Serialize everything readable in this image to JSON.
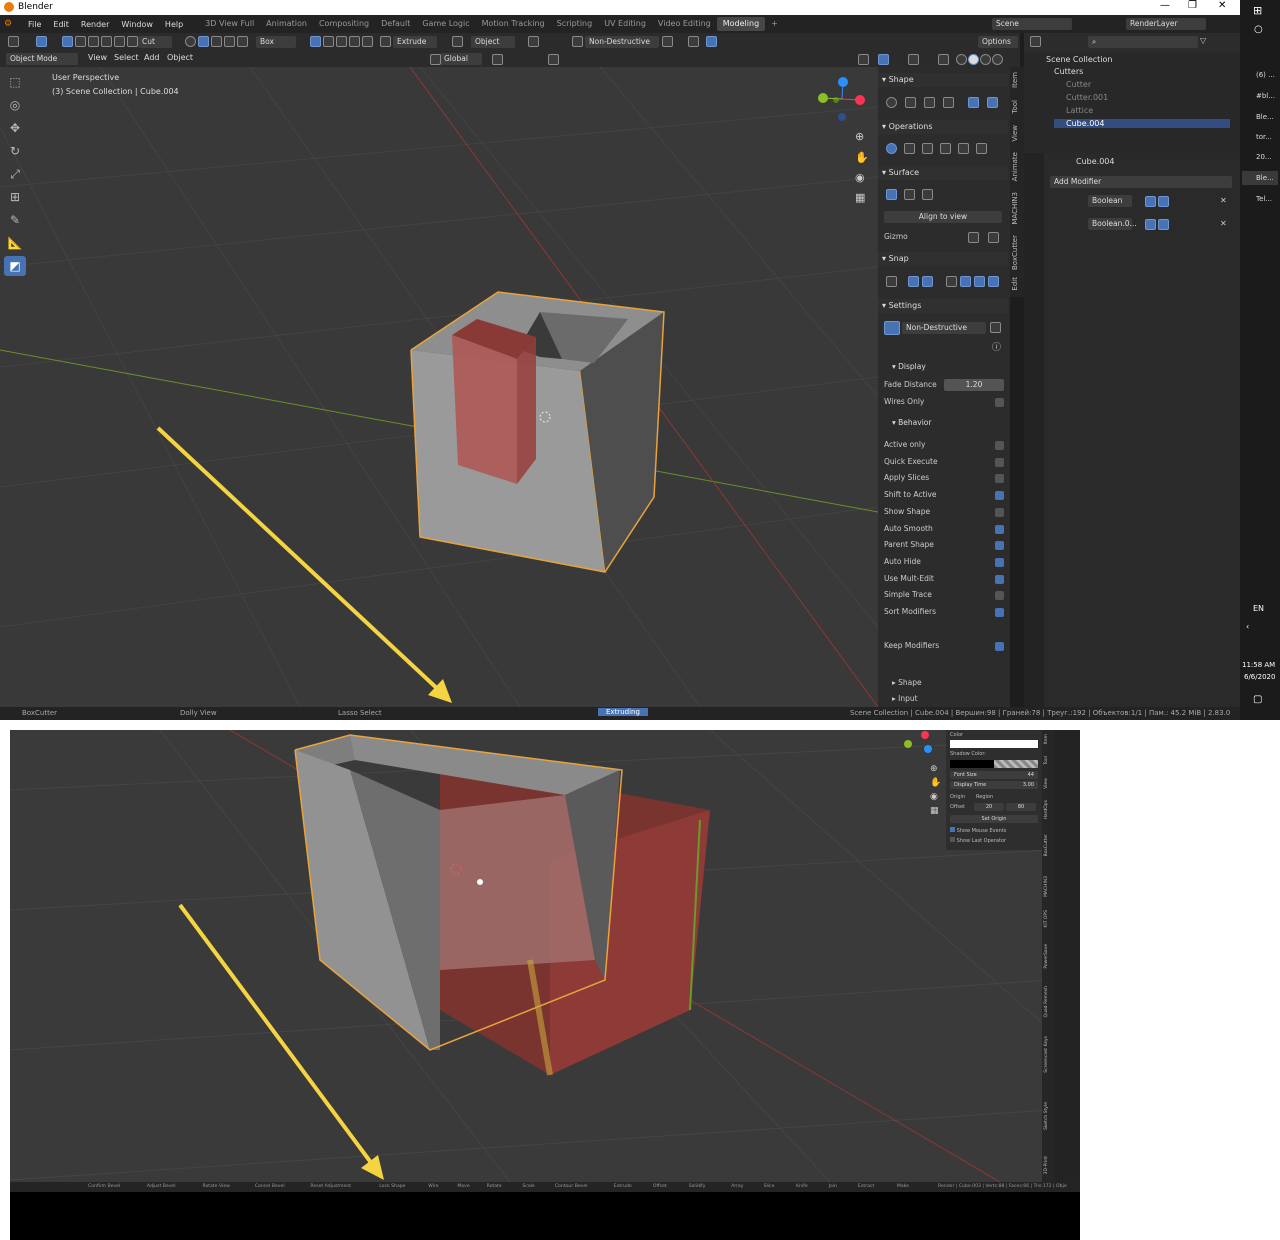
{
  "titlebar": {
    "title": "Blender"
  },
  "menus": [
    "File",
    "Edit",
    "Render",
    "Window",
    "Help"
  ],
  "workspaces": [
    "3D View Full",
    "Animation",
    "Compositing",
    "Default",
    "Game Logic",
    "Motion Tracking",
    "Scripting",
    "UV Editing",
    "Video Editing",
    "Modeling"
  ],
  "workspace_active": "Modeling",
  "scene": "Scene",
  "render_layer": "RenderLayer",
  "toolbar": {
    "cut": "Cut",
    "box": "Box",
    "extrude": "Extrude",
    "object": "Object",
    "non_destructive": "Non-Destructive",
    "options": "Options"
  },
  "header": {
    "mode": "Object Mode",
    "view": "View",
    "select": "Select",
    "add": "Add",
    "object": "Object",
    "orientation": "Global"
  },
  "viewport": {
    "perspective": "User Perspective",
    "collection": "(3) Scene Collection | Cube.004"
  },
  "npanel": {
    "shape": "Shape",
    "operations": "Operations",
    "surface": "Surface",
    "align_to_view": "Align to view",
    "gizmo": "Gizmo",
    "snap": "Snap",
    "settings": "Settings",
    "mode": "Non-Destructive",
    "display": "Display",
    "fade_distance_label": "Fade Distance",
    "fade_distance": "1.20",
    "wires_only": "Wires Only",
    "behavior": "Behavior",
    "behavior_items": [
      {
        "label": "Active only",
        "on": false
      },
      {
        "label": "Quick Execute",
        "on": false
      },
      {
        "label": "Apply Slices",
        "on": false
      },
      {
        "label": "Shift to Active",
        "on": true
      },
      {
        "label": "Show Shape",
        "on": false
      },
      {
        "label": "Auto Smooth",
        "on": true
      },
      {
        "label": "Parent Shape",
        "on": true
      },
      {
        "label": "Auto Hide",
        "on": true
      },
      {
        "label": "Use Mult-Edit",
        "on": true
      },
      {
        "label": "Simple Trace",
        "on": false
      },
      {
        "label": "Sort Modifiers",
        "on": true
      }
    ],
    "keep_modifiers": "Keep Modifiers",
    "shape_sub": "Shape",
    "input_sub": "Input"
  },
  "vtabs": [
    "Item",
    "Tool",
    "View",
    "Animate",
    "MACHIN3",
    "BoxCutter",
    "Edit"
  ],
  "outliner": {
    "root": "Scene Collection",
    "items": [
      {
        "name": "Cutters",
        "depth": 1
      },
      {
        "name": "Cutter",
        "depth": 2
      },
      {
        "name": "Cutter.001",
        "depth": 2
      },
      {
        "name": "Lattice",
        "depth": 2
      },
      {
        "name": "Cube.004",
        "depth": 1
      }
    ]
  },
  "properties": {
    "object": "Cube.004",
    "add_modifier": "Add Modifier",
    "modifiers": [
      "Boolean",
      "Boolean.0..."
    ]
  },
  "statusbar": {
    "left": "BoxCutter",
    "dolly": "Dolly View",
    "lasso": "Lasso Select",
    "extruding": "Extruding",
    "right": "Scene Collection | Cube.004 | Вершин:98 | Граней:78 | Треуг.:192 | Объектов:1/1 | Пам.: 45.2 MiB | 2.83.0"
  },
  "taskbar": {
    "items": [
      "(6) ...",
      "#bl...",
      "Ble...",
      "tor...",
      "20...",
      "Ble...",
      "Tel..."
    ],
    "lang": "EN",
    "time": "11:58 AM",
    "date": "6/6/2020"
  },
  "bottom": {
    "panel": {
      "color": "Color",
      "shadow_color": "Shadow Color:",
      "font_size": "Font Size",
      "font_size_val": "44",
      "display_time": "Display Time",
      "display_time_val": "3.00",
      "origin": "Origin",
      "region": "Region",
      "offset": "Offset",
      "offset_x": "20",
      "offset_y": "80",
      "set_origin": "Set Origin",
      "show_mouse": "Show Mouse Events",
      "show_last": "Show Last Operator"
    },
    "vtabs": [
      "Item",
      "Tool",
      "View",
      "HardOps",
      "BoxCutter",
      "MACHIN3",
      "KIT OPS",
      "PowerSave",
      "Quad Remesh",
      "Screencast Keys",
      "Sketch Style",
      "3D-Print"
    ],
    "status": [
      "Confirm Bevel",
      "Adjust Bevel",
      "Rotate View",
      "Cancel Bevel",
      "Reset Adjustment",
      "Lock Shape",
      "Wire",
      "Move",
      "Rotate",
      "Scale",
      "Contour Bevel",
      "Extrude",
      "Offset",
      "Solidify",
      "Array",
      "Slice",
      "Knife",
      "Join",
      "Extract",
      "Make"
    ],
    "status_right": "Render | Cube.003 | Verts:88 | Faces:66 | Tris:172 | Obje"
  },
  "colors": {
    "accent": "#4772b3",
    "arrow": "#f5d442",
    "selection": "#e8a33d",
    "cutter": "#8a3a36"
  }
}
